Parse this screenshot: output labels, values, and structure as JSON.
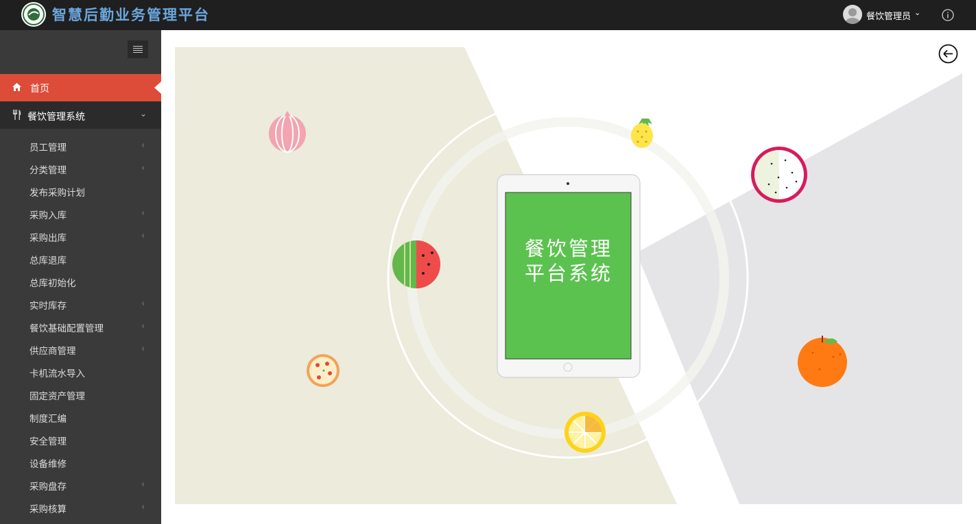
{
  "header": {
    "app_title": "智慧后勤业务管理平台",
    "user_name": "餐饮管理员",
    "icons": {
      "logo": "school-emblem-icon",
      "avatar": "user-avatar-icon",
      "user_menu": "chevron-down-icon",
      "info": "info-circle-icon"
    }
  },
  "sidebar": {
    "toggle_icon": "hamburger-icon",
    "home": {
      "label": "首页",
      "icon": "home-icon",
      "active": true
    },
    "group": {
      "label": "餐饮管理系统",
      "icon": "fork-knife-icon",
      "expanded": true
    },
    "items": [
      {
        "label": "员工管理",
        "has_children": true
      },
      {
        "label": "分类管理",
        "has_children": true
      },
      {
        "label": "发布采购计划",
        "has_children": false
      },
      {
        "label": "采购入库",
        "has_children": true
      },
      {
        "label": "采购出库",
        "has_children": true
      },
      {
        "label": "总库退库",
        "has_children": false
      },
      {
        "label": "总库初始化",
        "has_children": false
      },
      {
        "label": "实时库存",
        "has_children": true
      },
      {
        "label": "餐饮基础配置管理",
        "has_children": true
      },
      {
        "label": "供应商管理",
        "has_children": true
      },
      {
        "label": "卡机流水导入",
        "has_children": false
      },
      {
        "label": "固定资产管理",
        "has_children": false
      },
      {
        "label": "制度汇编",
        "has_children": false
      },
      {
        "label": "安全管理",
        "has_children": false
      },
      {
        "label": "设备维修",
        "has_children": false
      },
      {
        "label": "采购盘存",
        "has_children": true
      },
      {
        "label": "采购核算",
        "has_children": true
      }
    ]
  },
  "main": {
    "back_icon": "arrow-left-circle-icon",
    "screen_line1": "餐饮管理",
    "screen_line2": "平台系统",
    "colors": {
      "accent": "#dd4b39",
      "sidebar": "#3a3a3a",
      "topbar": "#1f1f1f",
      "screen_green": "#5bc24f",
      "beige": "#ecebdc",
      "grey": "#e5e5e8"
    }
  }
}
